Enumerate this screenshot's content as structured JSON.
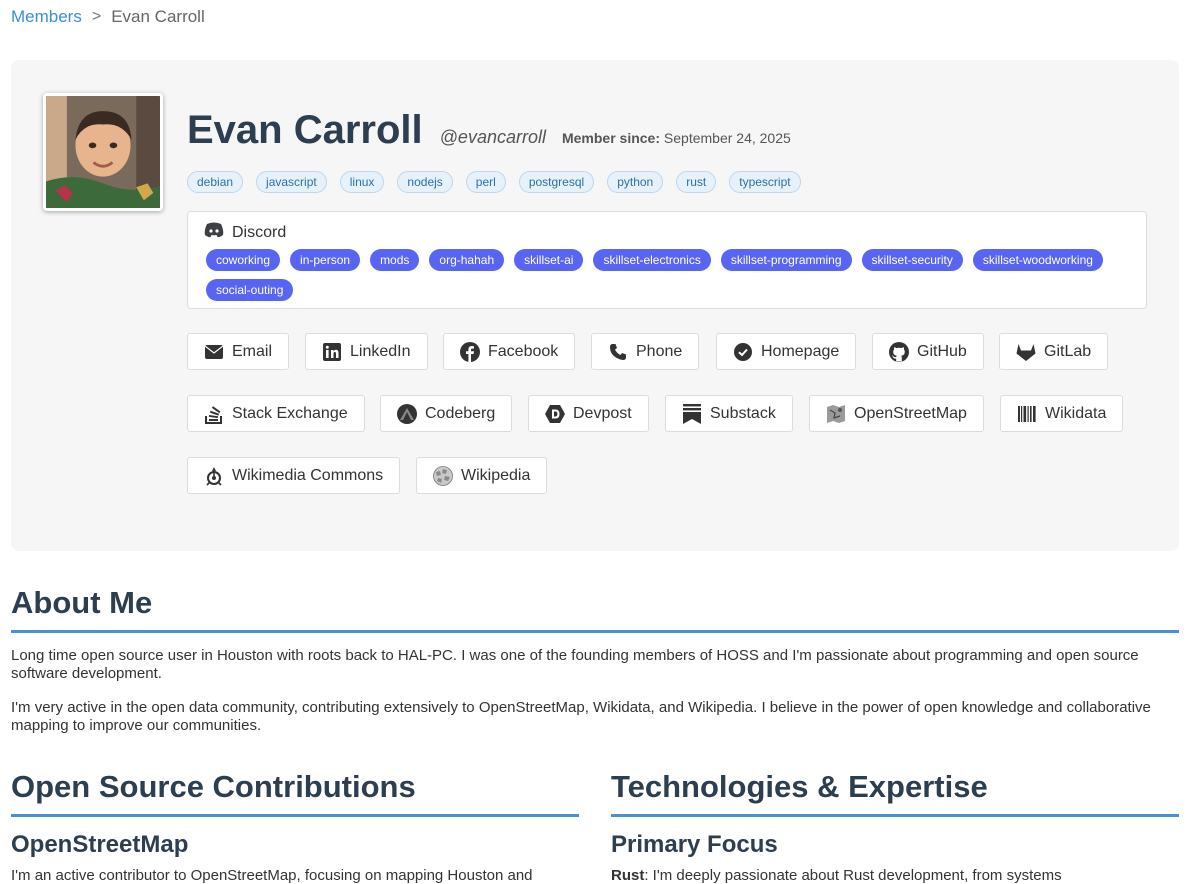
{
  "breadcrumb": {
    "parent": "Members",
    "separator": ">",
    "current": "Evan Carroll"
  },
  "profile": {
    "name": "Evan Carroll",
    "handle": "@evancarroll",
    "member_since_label": "Member since:",
    "member_since": "September 24, 2025",
    "tags": [
      "debian",
      "javascript",
      "linux",
      "nodejs",
      "perl",
      "postgresql",
      "python",
      "rust",
      "typescript"
    ]
  },
  "discord": {
    "label": "Discord",
    "roles": [
      "coworking",
      "in-person",
      "mods",
      "org-hahah",
      "skillset-ai",
      "skillset-electronics",
      "skillset-programming",
      "skillset-security",
      "skillset-woodworking",
      "social-outing"
    ]
  },
  "links": [
    {
      "label": "Email",
      "icon": "envelope-icon"
    },
    {
      "label": "LinkedIn",
      "icon": "linkedin-icon"
    },
    {
      "label": "Facebook",
      "icon": "facebook-icon"
    },
    {
      "label": "Phone",
      "icon": "phone-icon"
    },
    {
      "label": "Homepage",
      "icon": "check-circle-icon"
    },
    {
      "label": "GitHub",
      "icon": "github-icon"
    },
    {
      "label": "GitLab",
      "icon": "gitlab-icon"
    },
    {
      "label": "Stack Exchange",
      "icon": "stack-exchange-icon"
    },
    {
      "label": "Codeberg",
      "icon": "codeberg-icon"
    },
    {
      "label": "Devpost",
      "icon": "devpost-icon"
    },
    {
      "label": "Substack",
      "icon": "substack-icon"
    },
    {
      "label": "OpenStreetMap",
      "icon": "openstreetmap-icon"
    },
    {
      "label": "Wikidata",
      "icon": "wikidata-icon"
    },
    {
      "label": "Wikimedia Commons",
      "icon": "wikimedia-commons-icon"
    },
    {
      "label": "Wikipedia",
      "icon": "wikipedia-icon"
    }
  ],
  "about": {
    "heading": "About Me",
    "paragraphs": [
      "Long time open source user in Houston with roots back to HAL-PC. I was one of the founding members of HOSS and I'm passionate about programming and open source software development.",
      "I'm very active in the open data community, contributing extensively to OpenStreetMap, Wikidata, and Wikipedia. I believe in the power of open knowledge and collaborative mapping to improve our communities."
    ]
  },
  "contributions": {
    "heading": "Open Source Contributions",
    "sub_heading": "OpenStreetMap",
    "text": "I'm an active contributor to OpenStreetMap, focusing on mapping Houston and"
  },
  "tech": {
    "heading": "Technologies & Expertise",
    "sub_heading": "Primary Focus",
    "lead": "Rust",
    "text": ": I'm deeply passionate about Rust development, from systems"
  },
  "colors": {
    "accent": "#4a90d9",
    "link": "#3b8ed8",
    "discord": "#5865f2",
    "heading": "#2c3e50"
  }
}
